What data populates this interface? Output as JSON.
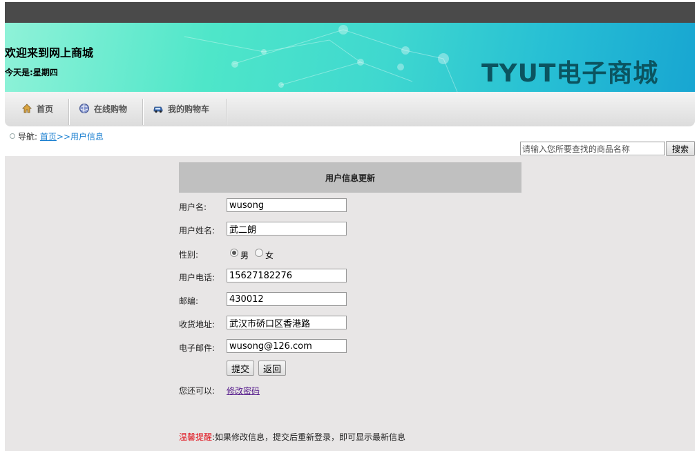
{
  "header": {
    "welcome": "欢迎来到网上商城",
    "today_label": "今天是:",
    "weekday": "星期四",
    "brand": "TYUT电子商城"
  },
  "nav": {
    "items": [
      {
        "label": "首页",
        "icon": "home-icon"
      },
      {
        "label": "在线购物",
        "icon": "globe-icon"
      },
      {
        "label": "我的购物车",
        "icon": "car-icon"
      }
    ]
  },
  "breadcrumb": {
    "prefix": "导航:",
    "home": "首页",
    "current": ">>用户信息"
  },
  "search": {
    "value": "请输入您所要查找的商品名称",
    "button": "搜索"
  },
  "form": {
    "title": "用户信息更新",
    "username": {
      "label": "用户名:",
      "value": "wusong"
    },
    "realname": {
      "label": "用户姓名:",
      "value": "武二朗"
    },
    "gender": {
      "label": "性别:",
      "male": "男",
      "female": "女",
      "selected": "男"
    },
    "phone": {
      "label": "用户电话:",
      "value": "15627182276"
    },
    "zip": {
      "label": "邮编:",
      "value": "430012"
    },
    "address": {
      "label": "收货地址:",
      "value": "武汉市硚口区香港路"
    },
    "email": {
      "label": "电子邮件:",
      "value": "wusong@126.com"
    },
    "submit": "提交",
    "back": "返回",
    "also_label": "您还可以:",
    "change_password": "修改密码"
  },
  "tip": {
    "title": "温馨提醒",
    "text": ":如果修改信息，提交后重新登录，即可显示最新信息"
  },
  "colors": {
    "brand_text": "#0b5460",
    "tip_red": "#e0141e",
    "link": "#1a7fd0"
  }
}
